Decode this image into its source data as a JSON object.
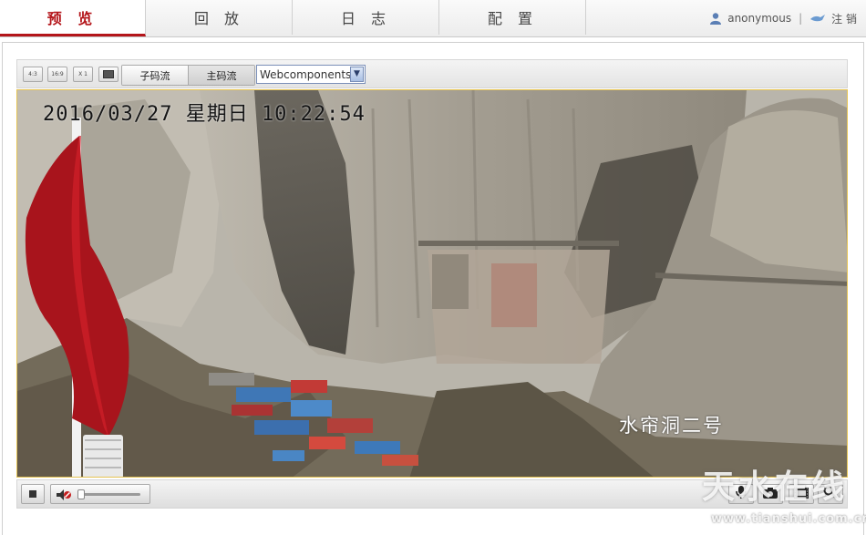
{
  "nav": {
    "tabs": [
      {
        "label": "预 览"
      },
      {
        "label": "回 放"
      },
      {
        "label": "日 志"
      },
      {
        "label": "配 置"
      }
    ],
    "username": "anonymous",
    "separator": "|",
    "logout_label": "注 销"
  },
  "toolbar": {
    "ratio_4_3": "4:3",
    "ratio_16_9": "16:9",
    "ratio_x1": "X 1",
    "sub_stream": "子码流",
    "main_stream": "主码流",
    "plugin": "Webcomponents"
  },
  "video": {
    "osd_time": "2016/03/27 星期日 10:22:54",
    "osd_name": "水帘洞二号"
  },
  "controls": {
    "volume_level": 0.05
  },
  "watermark": {
    "text": "天水在线",
    "url": "www.tianshui.com.cn"
  },
  "colors": {
    "accent": "#b4151a",
    "video_border": "#e6c453"
  }
}
